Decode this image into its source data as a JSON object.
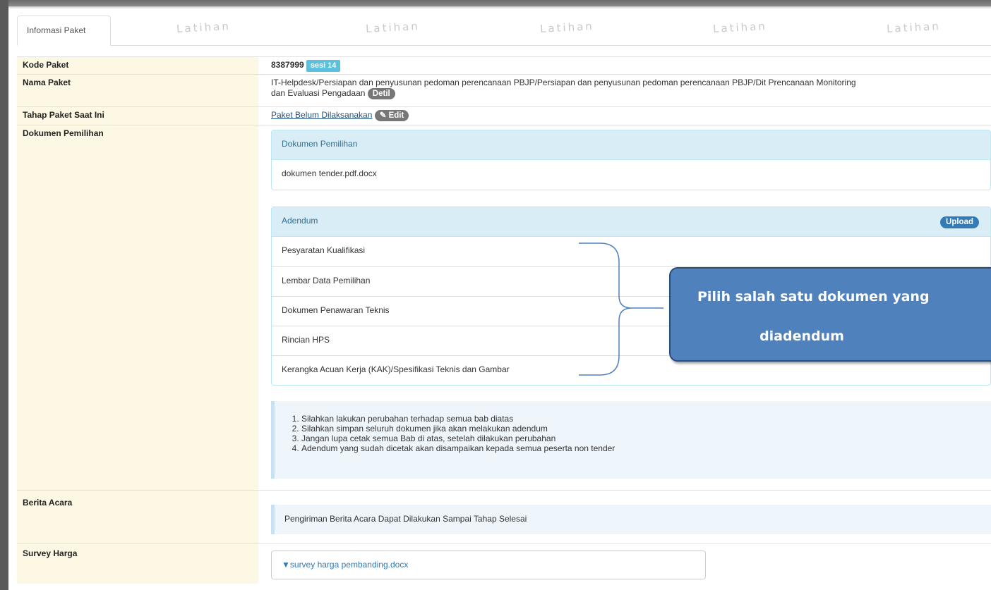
{
  "tab": {
    "label": "Informasi Paket"
  },
  "watermark": {
    "text": "Latihan"
  },
  "rows": {
    "kode": {
      "label": "Kode Paket",
      "value": "8387999",
      "badge": "sesi 14"
    },
    "nama": {
      "label": "Nama Paket",
      "value_line1": "IT-Helpdesk/Persiapan dan penyusunan pedoman perencanaan PBJP/Persiapan dan penyusunan pedoman perencanaan PBJP/Dit Prencanaan Monitoring",
      "value_line2": "dan Evaluasi Pengadaan",
      "detail_button": "Detil"
    },
    "tahap": {
      "label": "Tahap Paket Saat Ini",
      "link": "Paket Belum Dilaksanakan",
      "edit_button": "Edit"
    },
    "dokumen": {
      "label": "Dokumen Pemilihan"
    },
    "berita": {
      "label": "Berita Acara",
      "info": "Pengiriman Berita Acara Dapat Dilakukan Sampai Tahap Selesai"
    },
    "survey": {
      "label": "Survey Harga",
      "file": "survey harga pembanding.docx"
    }
  },
  "dokumen_panel": {
    "title": "Dokumen Pemilihan",
    "file": "dokumen tender.pdf.docx"
  },
  "adendum_panel": {
    "title": "Adendum",
    "upload_button": "Upload",
    "items": [
      "Pesyaratan Kualifikasi",
      "Lembar Data Pemilihan",
      "Dokumen Penawaran Teknis",
      "Rincian HPS",
      "Kerangka Acuan Kerja (KAK)/Spesifikasi Teknis dan Gambar"
    ]
  },
  "notes": [
    "Silahkan lakukan perubahan terhadap semua bab diatas",
    "Silahkan simpan seluruh dokumen jika akan melakukan adendum",
    "Jangan lupa cetak semua Bab di atas, setelah dilakukan perubahan",
    "Adendum yang sudah dicetak akan disampaikan kepada semua peserta non tender"
  ],
  "callout": {
    "line1": "Pilih salah satu dokumen yang",
    "line2": "diadendum"
  },
  "colors": {
    "label_bg": "#fcf8e3",
    "panel_header": "#d9edf7",
    "callout": "#4f81bd",
    "badge": "#5bc0de"
  }
}
